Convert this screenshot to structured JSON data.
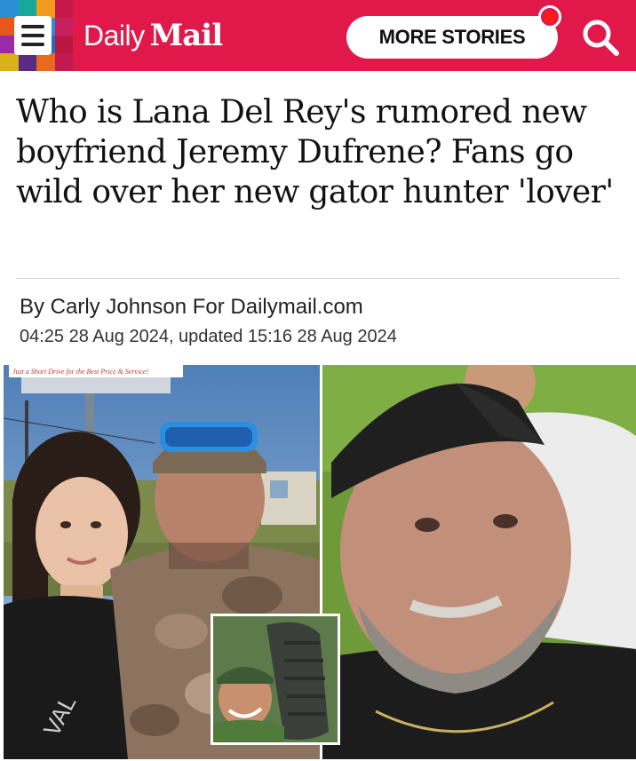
{
  "header": {
    "brand_daily": "Daily",
    "brand_mail": "Mail",
    "more_stories_label": "MORE STORIES",
    "icons": {
      "menu": "hamburger-menu-icon",
      "search": "search-icon",
      "notification": "notification-dot-icon"
    },
    "colors": {
      "brand_red": "#e1194a"
    }
  },
  "article": {
    "headline": "Who is Lana Del Rey's rumored new boyfriend Jeremy Dufrene? Fans go wild over her new gator hunter 'lover'",
    "byline": "By Carly Johnson For Dailymail.com",
    "dateline": "04:25 28 Aug 2024, updated 15:16 28 Aug 2024"
  },
  "photos": {
    "left_banner_text": "Just a Short Drive for the Best Price & Service!",
    "shirt_text": "VAL"
  }
}
